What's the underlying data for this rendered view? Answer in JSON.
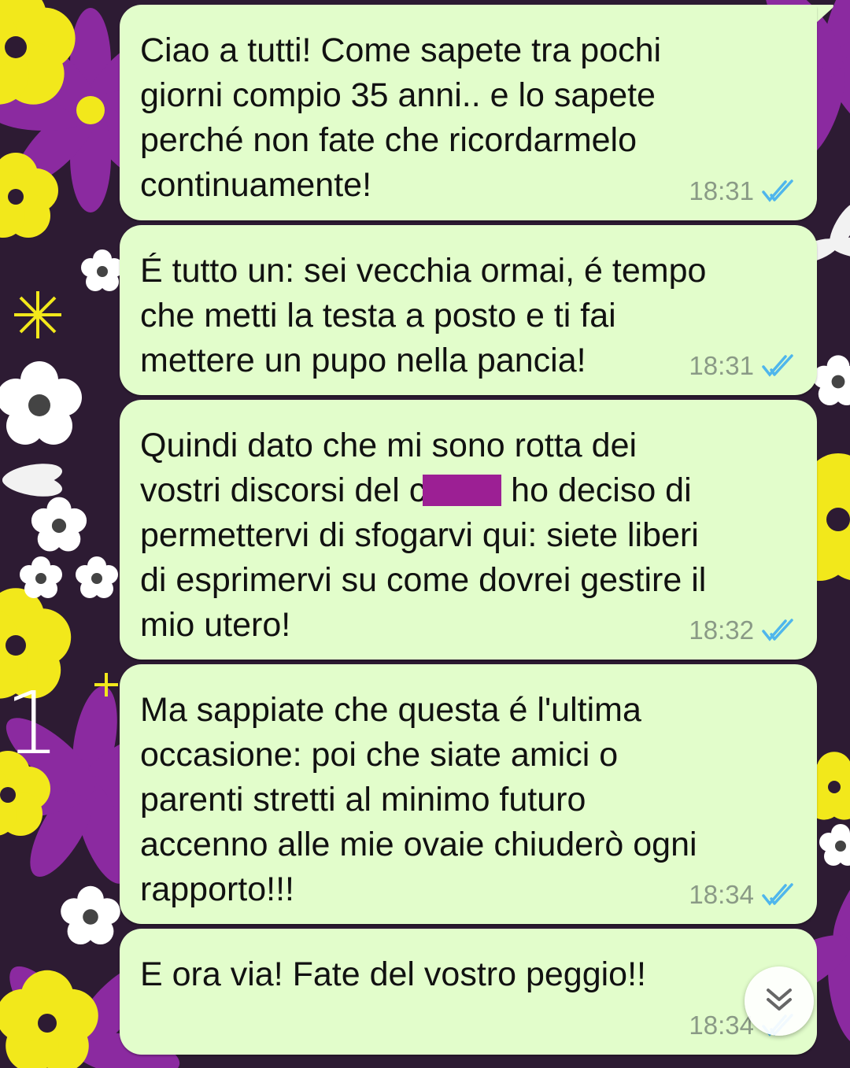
{
  "chat": {
    "messages": [
      {
        "text": "Ciao a tutti! Come sapete tra pochi\ngiorni compio 35 anni.. e lo sapete\nperché non fate che ricordarmelo\ncontinuamente!",
        "time": "18:31",
        "status": "read"
      },
      {
        "text": "É tutto un: sei vecchia ormai, é tempo\nche metti la testa a posto e ti fai\nmettere un pupo nella pancia!",
        "time": "18:31",
        "status": "read"
      },
      {
        "text_before": "Quindi dato che mi sono rotta dei\nvostri discorsi del c",
        "text_after": " ho deciso di\npermettervi di sfogarvi qui: siete liberi\ndi esprimervi su come dovrei gestire il\nmio utero!",
        "time": "18:32",
        "status": "read"
      },
      {
        "text": "Ma sappiate che questa é l'ultima\noccasione: poi che siate amici o\nparenti stretti al minimo futuro\naccenno alle mie ovaie chiuderò ogni\nrapporto!!!",
        "time": "18:34",
        "status": "read"
      },
      {
        "text": "E ora via! Fate del vostro peggio!!",
        "time": "18:34",
        "status": "read"
      }
    ]
  },
  "annotation": {
    "label": "1"
  },
  "icons": {
    "read_ticks": "double-check-icon",
    "scroll_down": "double-chevron-down-icon"
  },
  "colors": {
    "bubble": "#e2fdcb",
    "ticks": "#4fb6ec",
    "redaction": "#9c1f94",
    "wallpaper": "#2d1b33"
  }
}
